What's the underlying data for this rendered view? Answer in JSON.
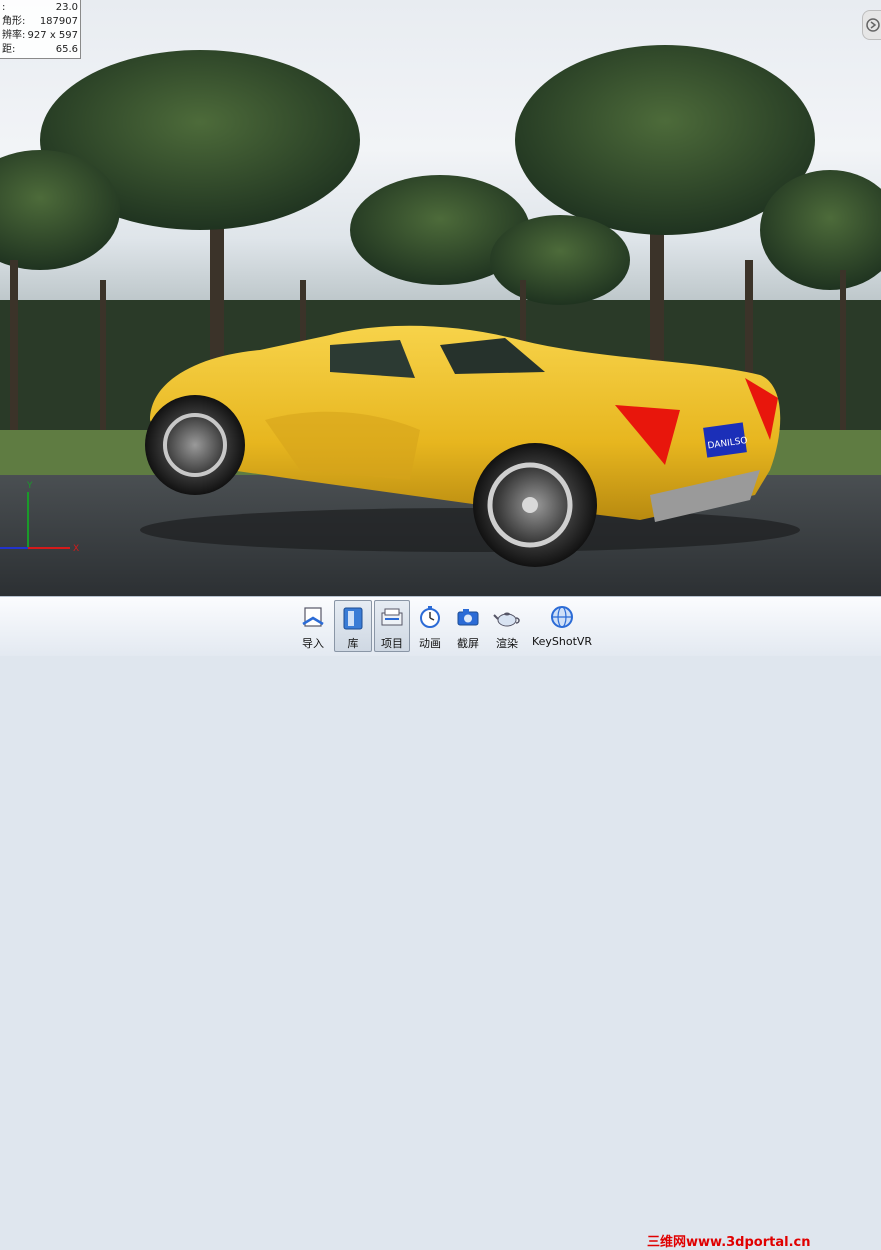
{
  "stats": {
    "rows": [
      {
        "label": ":",
        "value": "23.0"
      },
      {
        "label": "角形:",
        "value": "187907"
      },
      {
        "label": "辨率:",
        "value": "927 x 597"
      },
      {
        "label": "距:",
        "value": "65.6"
      }
    ]
  },
  "scene": {
    "plate_text": "DANILSO",
    "axes": {
      "y": "Y",
      "x": "X"
    }
  },
  "toolbar": {
    "buttons": [
      {
        "id": "import",
        "label": "导入",
        "icon": "import-icon"
      },
      {
        "id": "library",
        "label": "库",
        "icon": "library-icon"
      },
      {
        "id": "project",
        "label": "项目",
        "icon": "project-icon"
      },
      {
        "id": "animation",
        "label": "动画",
        "icon": "animation-icon"
      },
      {
        "id": "screenshot",
        "label": "截屏",
        "icon": "camera-icon"
      },
      {
        "id": "render",
        "label": "渲染",
        "icon": "render-teapot-icon"
      },
      {
        "id": "keyshotvr",
        "label": "KeyShotVR",
        "icon": "globe-icon"
      }
    ]
  },
  "watermark": "三维网www.3dportal.cn",
  "colors": {
    "car": "#f0c22a",
    "taillight": "#e8160c",
    "plate": "#1b2fb8",
    "watermark": "#e00000"
  }
}
